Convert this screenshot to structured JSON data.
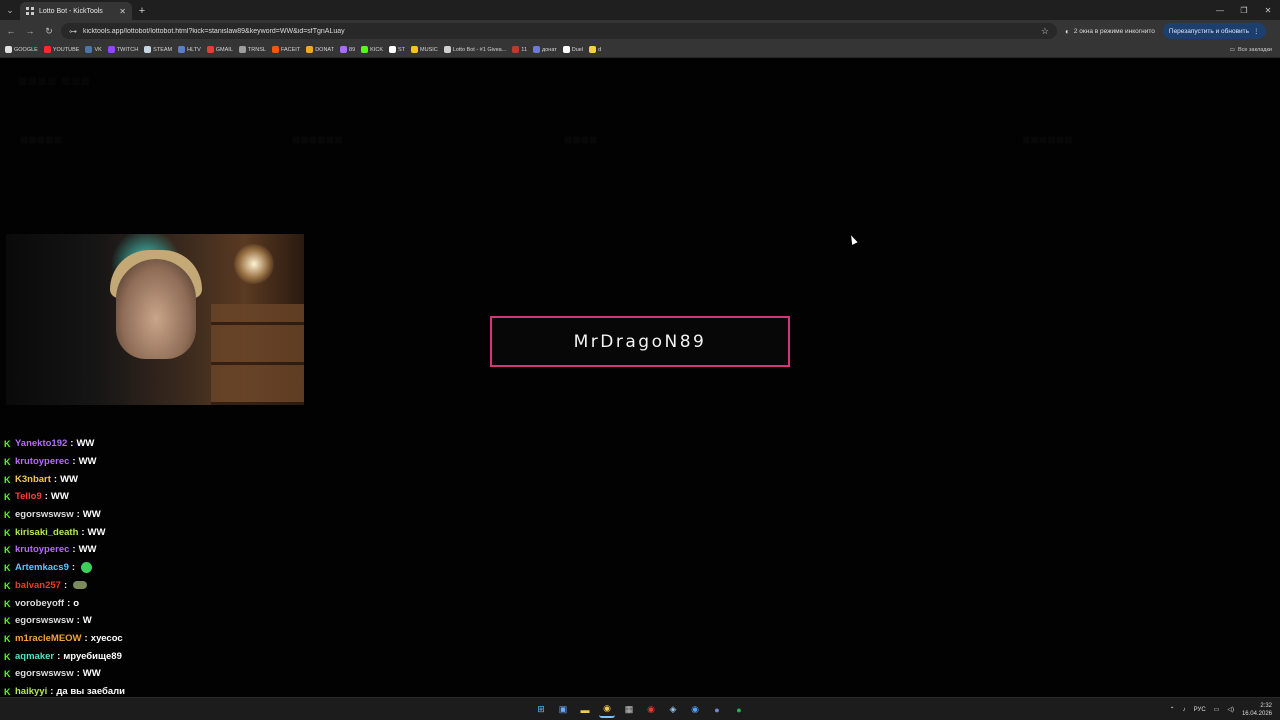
{
  "browser": {
    "tab_title": "Lotto Bot - KickTools",
    "new_tab": "+",
    "url": "kicktools.app/lottobot/lottobot.html?kick=stanislaw89&keyword=WW&id=sfTgnALuay",
    "incognito_label": "2 окна в режиме инкогнито",
    "relaunch_label": "Перезапустить и обновить",
    "all_bookmarks": "Все закладки"
  },
  "bookmarks": [
    {
      "label": "GOOGLE",
      "color": "#e0e0e0"
    },
    {
      "label": "YOUTUBE",
      "color": "#ff2a2a"
    },
    {
      "label": "VK",
      "color": "#4a76a8"
    },
    {
      "label": "TWITCH",
      "color": "#9146ff"
    },
    {
      "label": "STEAM",
      "color": "#c7d5e0"
    },
    {
      "label": "HLTV",
      "color": "#5a7ec8"
    },
    {
      "label": "GMAIL",
      "color": "#d44638"
    },
    {
      "label": "TRNSL",
      "color": "#9e9e9e"
    },
    {
      "label": "FACEIT",
      "color": "#ff5500"
    },
    {
      "label": "DONAT",
      "color": "#f5a623"
    },
    {
      "label": "89",
      "color": "#a86cff"
    },
    {
      "label": "KICK",
      "color": "#53fc18"
    },
    {
      "label": "ST",
      "color": "#ffffff"
    },
    {
      "label": "MUSIC",
      "color": "#f5c518"
    },
    {
      "label": "Lotto Bot - #1 Givea...",
      "color": "#cfcfcf"
    },
    {
      "label": "11",
      "color": "#c0392b"
    },
    {
      "label": "донат",
      "color": "#6c7ae0"
    },
    {
      "label": "Duel",
      "color": "#ffffff"
    },
    {
      "label": "d",
      "color": "#f5d23c"
    }
  ],
  "winner": {
    "name": "MrDragoN89",
    "border_color": "#d6337a"
  },
  "chat": [
    {
      "user": "Yanekto192",
      "color": "#b26bff",
      "message": "WW"
    },
    {
      "user": "krutoyperec",
      "color": "#b26bff",
      "message": "WW"
    },
    {
      "user": "K3nbart",
      "color": "#f2c94c",
      "message": "WW"
    },
    {
      "user": "Tello9",
      "color": "#ff3b3b",
      "message": "WW"
    },
    {
      "user": "egorswswsw",
      "color": "#dddddd",
      "message": "WW"
    },
    {
      "user": "kirisaki_death",
      "color": "#b5e853",
      "message": "WW"
    },
    {
      "user": "krutoyperec",
      "color": "#b26bff",
      "message": "WW"
    },
    {
      "user": "Artemkacs9",
      "color": "#59c7ff",
      "message": "",
      "emote": "green"
    },
    {
      "user": "balvan257",
      "color": "#e0412e",
      "message": "",
      "emote": "olive"
    },
    {
      "user": "vorobeyoff",
      "color": "#dddddd",
      "message": "o"
    },
    {
      "user": "egorswswsw",
      "color": "#dddddd",
      "message": "W"
    },
    {
      "user": "m1racleMEOW",
      "color": "#f2a33a",
      "message": "хуесос"
    },
    {
      "user": "aqmaker",
      "color": "#59e0c2",
      "message": "мруебище89"
    },
    {
      "user": "egorswswsw",
      "color": "#dddddd",
      "message": "WW"
    },
    {
      "user": "haikyyi",
      "color": "#b5e853",
      "message": "да вы заебали"
    }
  ],
  "taskbar": {
    "lang": "РУС",
    "time": "2:32",
    "date": "16.04.2026"
  }
}
